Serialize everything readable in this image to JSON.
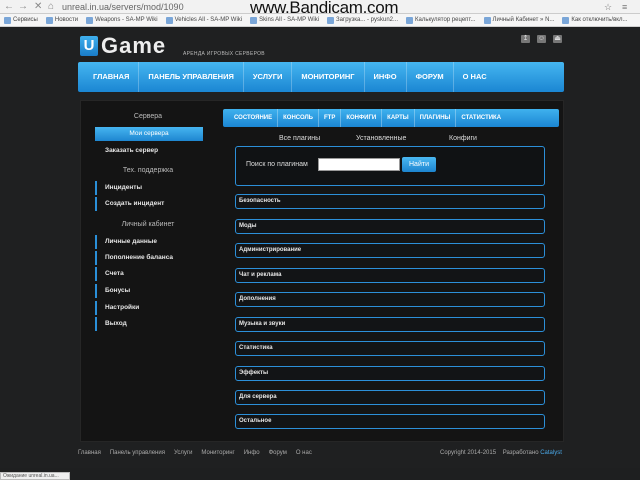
{
  "browser": {
    "url": "unreal.in.ua/servers/mod/1090",
    "watermark": "www.Bandicam.com",
    "bookmarks": [
      "Сервисы",
      "Новости",
      "Weapons - SA-MP Wiki",
      "Vehicles All - SA-MP Wiki",
      "Skins All - SA-MP Wiki",
      "Загрузка... - pyskun2...",
      "Калькулятор рецепт...",
      "Личный Кабинет » N...",
      "Как отключить/вкл..."
    ],
    "status": "Ожидание unreal.in.ua..."
  },
  "header": {
    "logo_letter": "U",
    "logo_text": "Game",
    "tagline": "АРЕНДА ИГРОВЫХ СЕРВЕРОВ",
    "nav": [
      "ГЛАВНАЯ",
      "ПАНЕЛЬ УПРАВЛЕНИЯ",
      "УСЛУГИ",
      "МОНИТОРИНГ",
      "ИНФО",
      "ФОРУМ",
      "О НАС"
    ]
  },
  "sidebar": {
    "sections": [
      {
        "title": "Сервера",
        "items": [
          "Мои сервера",
          "Заказать сервер"
        ]
      },
      {
        "title": "Тех. поддержка",
        "items": [
          "Инциденты",
          "Создать инцидент"
        ]
      },
      {
        "title": "Личный кабинет",
        "items": [
          "Личные данные",
          "Пополнение баланса",
          "Счета",
          "Бонусы",
          "Настройки",
          "Выход"
        ]
      }
    ]
  },
  "tabs": [
    "СОСТОЯНИЕ",
    "КОНСОЛЬ",
    "FTP",
    "КОНФИГИ",
    "КАРТЫ",
    "ПЛАГИНЫ",
    "СТАТИСТИКА"
  ],
  "subtabs": [
    "Все плагины",
    "Установленные",
    "Конфиги"
  ],
  "search": {
    "label": "Поиск по плагинам",
    "value": "",
    "button": "Найти"
  },
  "categories": [
    "Безопасность",
    "Моды",
    "Администрирование",
    "Чат и реклама",
    "Дополнения",
    "Музыка и звуки",
    "Статистика",
    "Эффекты",
    "Для сервера",
    "Остальное"
  ],
  "footer": {
    "links": [
      "Главная",
      "Панель управления",
      "Услуги",
      "Мониторинг",
      "Инфо",
      "Форум",
      "О нас"
    ],
    "copyright": "Copyright 2014-2015",
    "dev_label": "Разработано",
    "dev_name": "Catalyst"
  }
}
